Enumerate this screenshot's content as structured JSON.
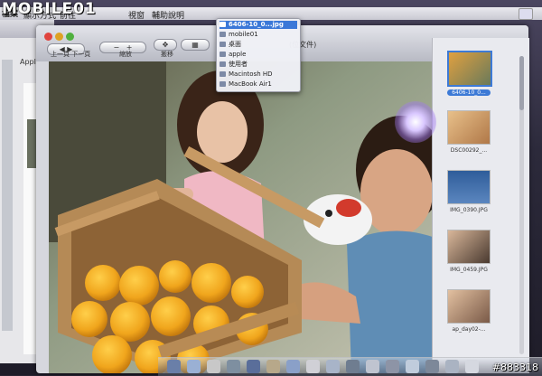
{
  "watermark": {
    "logo": "MOBILE01",
    "image_id": "#883318"
  },
  "menubar": {
    "items": [
      "檔案",
      "顯示方式",
      "前往",
      "視窗",
      "輔助說明"
    ]
  },
  "browser": {
    "tab_label": "Apple"
  },
  "toolbar": {
    "nav_label": "上一頁 下一頁",
    "zoom_label": "縮放",
    "move_label": "搬移",
    "window_title": "(位文件)"
  },
  "dropdown": {
    "items": [
      {
        "label": "6406-10_0...jpg",
        "selected": true
      },
      {
        "label": "mobile01",
        "selected": false
      },
      {
        "label": "桌面",
        "selected": false
      },
      {
        "label": "apple",
        "selected": false
      },
      {
        "label": "使用者",
        "selected": false
      },
      {
        "label": "Macintosh HD",
        "selected": false
      },
      {
        "label": "MacBook Air1",
        "selected": false
      }
    ]
  },
  "sidebar": {
    "thumbnails": [
      {
        "caption": "6406-10_0...",
        "selected": true
      },
      {
        "caption": "DSC00292_...",
        "selected": false
      },
      {
        "caption": "IMG_0390.JPG",
        "selected": false
      },
      {
        "caption": "IMG_0459.JPG",
        "selected": false
      },
      {
        "caption": "ap_day02-...",
        "selected": false
      }
    ]
  },
  "colors": {
    "selection": "#3b78d8",
    "close": "#e0443e",
    "minimize": "#dea123",
    "zoom": "#4fb03e"
  }
}
